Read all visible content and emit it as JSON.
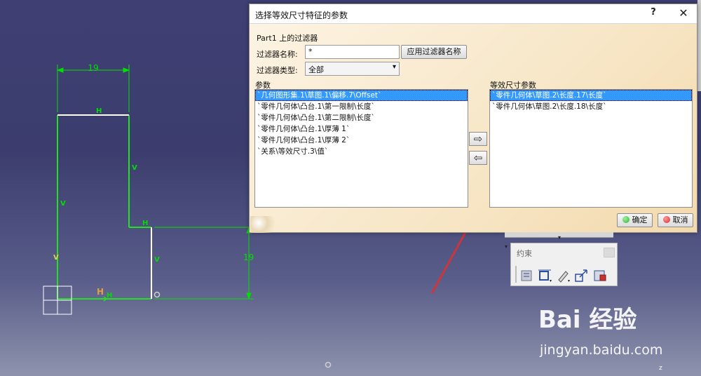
{
  "dialog": {
    "title": "选择等效尺寸特征的参数",
    "help": "?",
    "close": "✕",
    "filter_section_label": "Part1 上的过滤器",
    "filter_name_label": "过滤器名称:",
    "filter_name_value": "*",
    "apply_filter_button": "应用过滤器名称",
    "filter_type_label": "过滤器类型:",
    "filter_type_value": "全部",
    "params_label": "参数",
    "params": [
      "`几何图形集.1\\草图.1\\偏移.7\\Offset`",
      "`零件几何体\\凸台.1\\第一限制\\长度`",
      "`零件几何体\\凸台.1\\第二限制\\长度`",
      "`零件几何体\\凸台.1\\厚薄 1`",
      "`零件几何体\\凸台.1\\厚薄 2`",
      "`关系\\等效尺寸.3\\值`"
    ],
    "equiv_label": "等效尺寸参数",
    "equiv_params": [
      "`零件几何体\\草图.2\\长度.17\\长度`",
      "`零件几何体\\草图.2\\长度.18\\长度`"
    ],
    "add_arrow": "⇨",
    "remove_arrow": "⇦",
    "ok_button": "确定",
    "cancel_button": "取消",
    "ok_color": "#2fb52f",
    "cancel_color": "#d42a2a"
  },
  "sketch": {
    "dim_top": "19",
    "dim_right": "19",
    "constraint_h": "H",
    "constraint_v": "V",
    "line_color": "#22e022",
    "dim_color": "#00e000",
    "background_color": "#3f3f74"
  },
  "toolbar": {
    "title": "约束",
    "strip_arrows": "▾ ▾ ▾"
  },
  "watermark": {
    "logo": "Bai 经验",
    "url": "jingyan.baidu.com"
  },
  "annotation": {
    "arrow_color": "#e03030"
  }
}
